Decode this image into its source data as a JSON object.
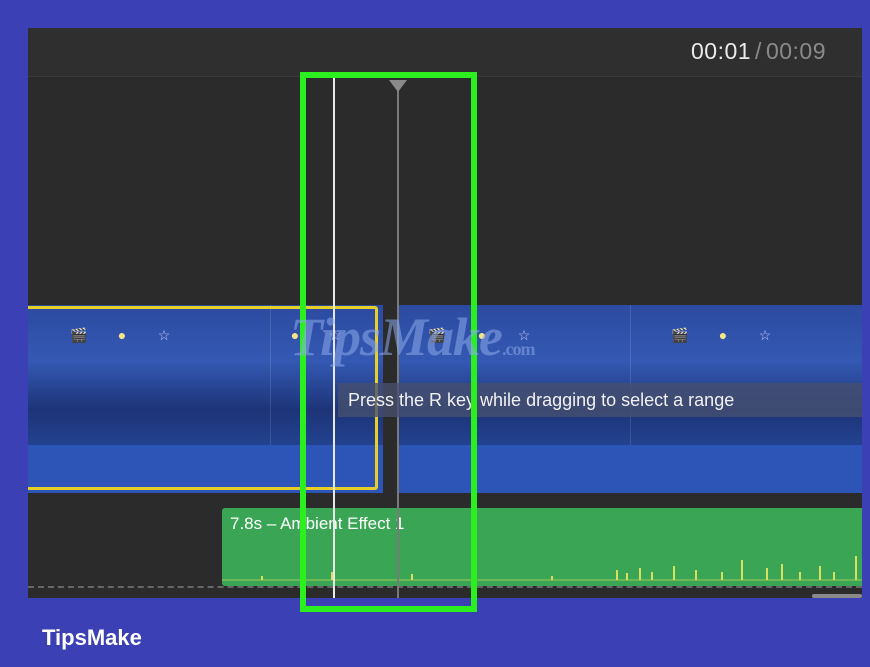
{
  "timecode": {
    "current": "00:01",
    "separator": "/",
    "total": "00:09"
  },
  "tooltip": {
    "text": "Press the R key while dragging to select a range"
  },
  "audio_clip": {
    "label": "7.8s – Ambient Effect 1"
  },
  "watermark": {
    "main": "TipsMake",
    "suffix": ".com"
  },
  "brand": {
    "name": "TipsMake"
  },
  "colors": {
    "frame": "#3b40b5",
    "selection_yellow": "#e5cf28",
    "highlight_green": "#2bef1f",
    "audio_green": "#3aa655",
    "clip_blue": "#2c55b7"
  },
  "icons": [
    "film-icon",
    "sun-icon",
    "star-icon"
  ]
}
